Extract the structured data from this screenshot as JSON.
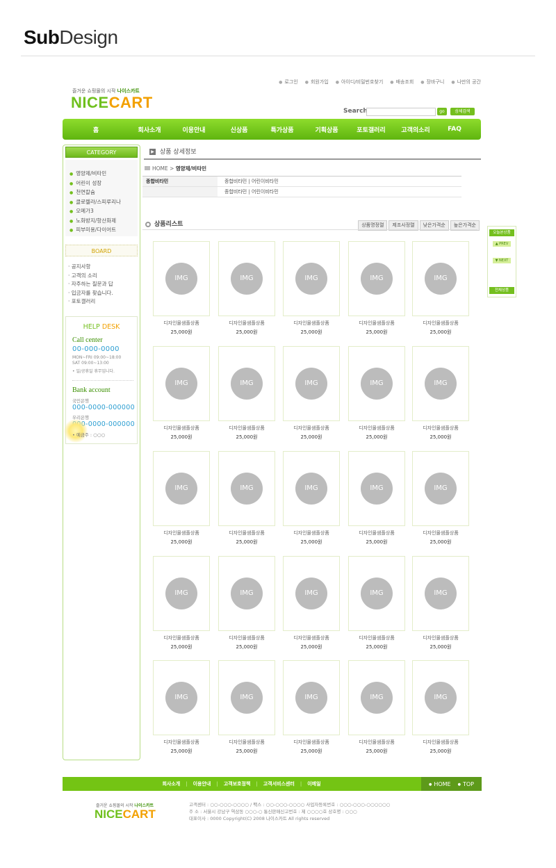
{
  "page_heading": {
    "bold": "Sub",
    "rest": "Design"
  },
  "top_links": [
    "로그인",
    "회원가입",
    "아이디/비밀번호찾기",
    "배송조회",
    "장바구니",
    "나만의 공간"
  ],
  "tagline": {
    "text": "즐거운 쇼핑몰의 시작",
    "brand": "나이스카트"
  },
  "logo": {
    "part1": "NICE",
    "part2": "CART"
  },
  "search": {
    "label": "Search",
    "placeholder": "",
    "go_label": "go",
    "advanced_label": "상세검색"
  },
  "nav": [
    "홈",
    "회사소개",
    "이용안내",
    "신상품",
    "특가상품",
    "기획상품",
    "포토갤러리",
    "고객의소리",
    "FAQ"
  ],
  "category": {
    "title": "CATEGORY",
    "items": [
      "영양제/비타민",
      "어린이 성장",
      "천연칼슘",
      "클로렐라/스피루리나",
      "오메가3",
      "노화방지/항산화제",
      "피부미용/다이어트"
    ]
  },
  "board": {
    "title": "BOARD",
    "items": [
      "공지사항",
      "고객의 소리",
      "자주하는 질문과 답",
      "입금자를 찾습니다.",
      "포토갤러리"
    ]
  },
  "helpdesk": {
    "title_a": "HELP",
    "title_b": "DESK",
    "call_title": "Call center",
    "phone": "00-000-0000",
    "hours1": "MON~FRI 09:00~18:00",
    "hours2": "SAT 09:00~13:00",
    "note": "• 일/공휴일 휴무입니다.",
    "bank_title": "Bank account",
    "bank1": "국민은행",
    "account1": "000-0000-000000",
    "bank2": "우리은행",
    "account2": "000-0000-000000",
    "holder": "• 예금주 : ○○○"
  },
  "content": {
    "title": "상품 상세정보",
    "breadcrumb_home": "HOME",
    "breadcrumb_sep": ">",
    "breadcrumb_current": "영양제/비타민",
    "sub_rows": [
      {
        "key": "종합비타민",
        "value": "종합비타민 | 어린이비타민"
      },
      {
        "key": "",
        "value": "종합비타민 | 어린이비타민"
      }
    ],
    "list_title": "상품리스트",
    "sort_tabs": [
      "상품명정렬",
      "제조사정렬",
      "낮은가격순",
      "높은가격순"
    ]
  },
  "products": {
    "img_label": "IMG",
    "items": [
      {
        "name": "디자인몰샘플상품",
        "price": "25,000원"
      },
      {
        "name": "디자인몰샘플상품",
        "price": "25,000원"
      },
      {
        "name": "디자인몰샘플상품",
        "price": "25,000원"
      },
      {
        "name": "디자인몰샘플상품",
        "price": "25,000원"
      },
      {
        "name": "디자인몰샘플상품",
        "price": "25,000원"
      },
      {
        "name": "디자인몰샘플상품",
        "price": "25,000원"
      },
      {
        "name": "디자인몰샘플상품",
        "price": "25,000원"
      },
      {
        "name": "디자인몰샘플상품",
        "price": "25,000원"
      },
      {
        "name": "디자인몰샘플상품",
        "price": "25,000원"
      },
      {
        "name": "디자인몰샘플상품",
        "price": "25,000원"
      },
      {
        "name": "디자인몰샘플상품",
        "price": "25,000원"
      },
      {
        "name": "디자인몰샘플상품",
        "price": "25,000원"
      },
      {
        "name": "디자인몰샘플상품",
        "price": "25,000원"
      },
      {
        "name": "디자인몰샘플상품",
        "price": "25,000원"
      },
      {
        "name": "디자인몰샘플상품",
        "price": "25,000원"
      },
      {
        "name": "디자인몰샘플상품",
        "price": "25,000원"
      },
      {
        "name": "디자인몰샘플상품",
        "price": "25,000원"
      },
      {
        "name": "디자인몰샘플상품",
        "price": "25,000원"
      },
      {
        "name": "디자인몰샘플상품",
        "price": "25,000원"
      },
      {
        "name": "디자인몰샘플상품",
        "price": "25,000원"
      },
      {
        "name": "디자인몰샘플상품",
        "price": "25,000원"
      },
      {
        "name": "디자인몰샘플상품",
        "price": "25,000원"
      },
      {
        "name": "디자인몰샘플상품",
        "price": "25,000원"
      },
      {
        "name": "디자인몰샘플상품",
        "price": "25,000원"
      },
      {
        "name": "디자인몰샘플상품",
        "price": "25,000원"
      }
    ]
  },
  "quick_menu": {
    "title": "오늘본상품",
    "prev": "▲ PREV",
    "next": "▼ NEXT",
    "footer": "전체상품"
  },
  "footer": {
    "links": [
      "회사소개",
      "이용안내",
      "고객보호정책",
      "고객서비스센터",
      "이메일"
    ],
    "home": "HOME",
    "top": "TOP",
    "tagline": "즐거운 쇼핑몰의 시작",
    "tagline_brand": "나이스카트",
    "info_line1": "고객센터 : ○○-○○○-○○○○ / 팩스 : ○○-○○○-○○○○     사업자등록번호 : ○○○-○○○-○○○○○○",
    "info_line2": "주 소 : 서울시 강남구 역삼동 ○○○-○     통신판매신고번호 : 제 ○○○○호     상호명 : ○○○",
    "info_line3": "대표이사 : 0000 Copyright(C) 2008 나이스카트 All rights reserved"
  },
  "colors": {
    "accent": "#74bf1e",
    "brand_orange": "#f2a000",
    "link_blue": "#2a9dd1"
  }
}
